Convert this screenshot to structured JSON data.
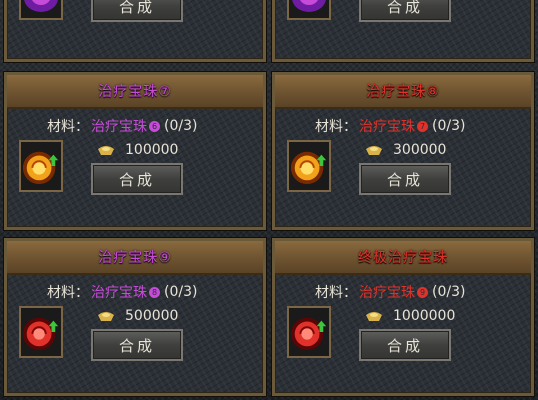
{
  "material_label": "材料：",
  "craft_label": "合成",
  "top_cards": [
    {
      "craft_label": "合成"
    },
    {
      "craft_label": "合成"
    }
  ],
  "cards": [
    {
      "title": "治疗宝珠⑦",
      "title_color": "purple",
      "material_name": "治疗宝珠",
      "material_level": "6",
      "material_count": "(0/3)",
      "cost": "100000",
      "gem_color": "#f2a11a",
      "craft_label": "合成"
    },
    {
      "title": "治疗宝珠⑧",
      "title_color": "red",
      "material_name": "治疗宝珠",
      "material_level": "7",
      "material_count": "(0/3)",
      "cost": "300000",
      "gem_color": "#f2a11a",
      "craft_label": "合成"
    },
    {
      "title": "治疗宝珠⑨",
      "title_color": "purple",
      "material_name": "治疗宝珠",
      "material_level": "8",
      "material_count": "(0/3)",
      "cost": "500000",
      "gem_color": "#e0322a",
      "craft_label": "合成"
    },
    {
      "title": "终极治疗宝珠",
      "title_color": "red",
      "material_name": "治疗宝珠",
      "material_level": "9",
      "material_count": "(0/3)",
      "cost": "1000000",
      "gem_color": "#e0322a",
      "craft_label": "合成"
    }
  ]
}
